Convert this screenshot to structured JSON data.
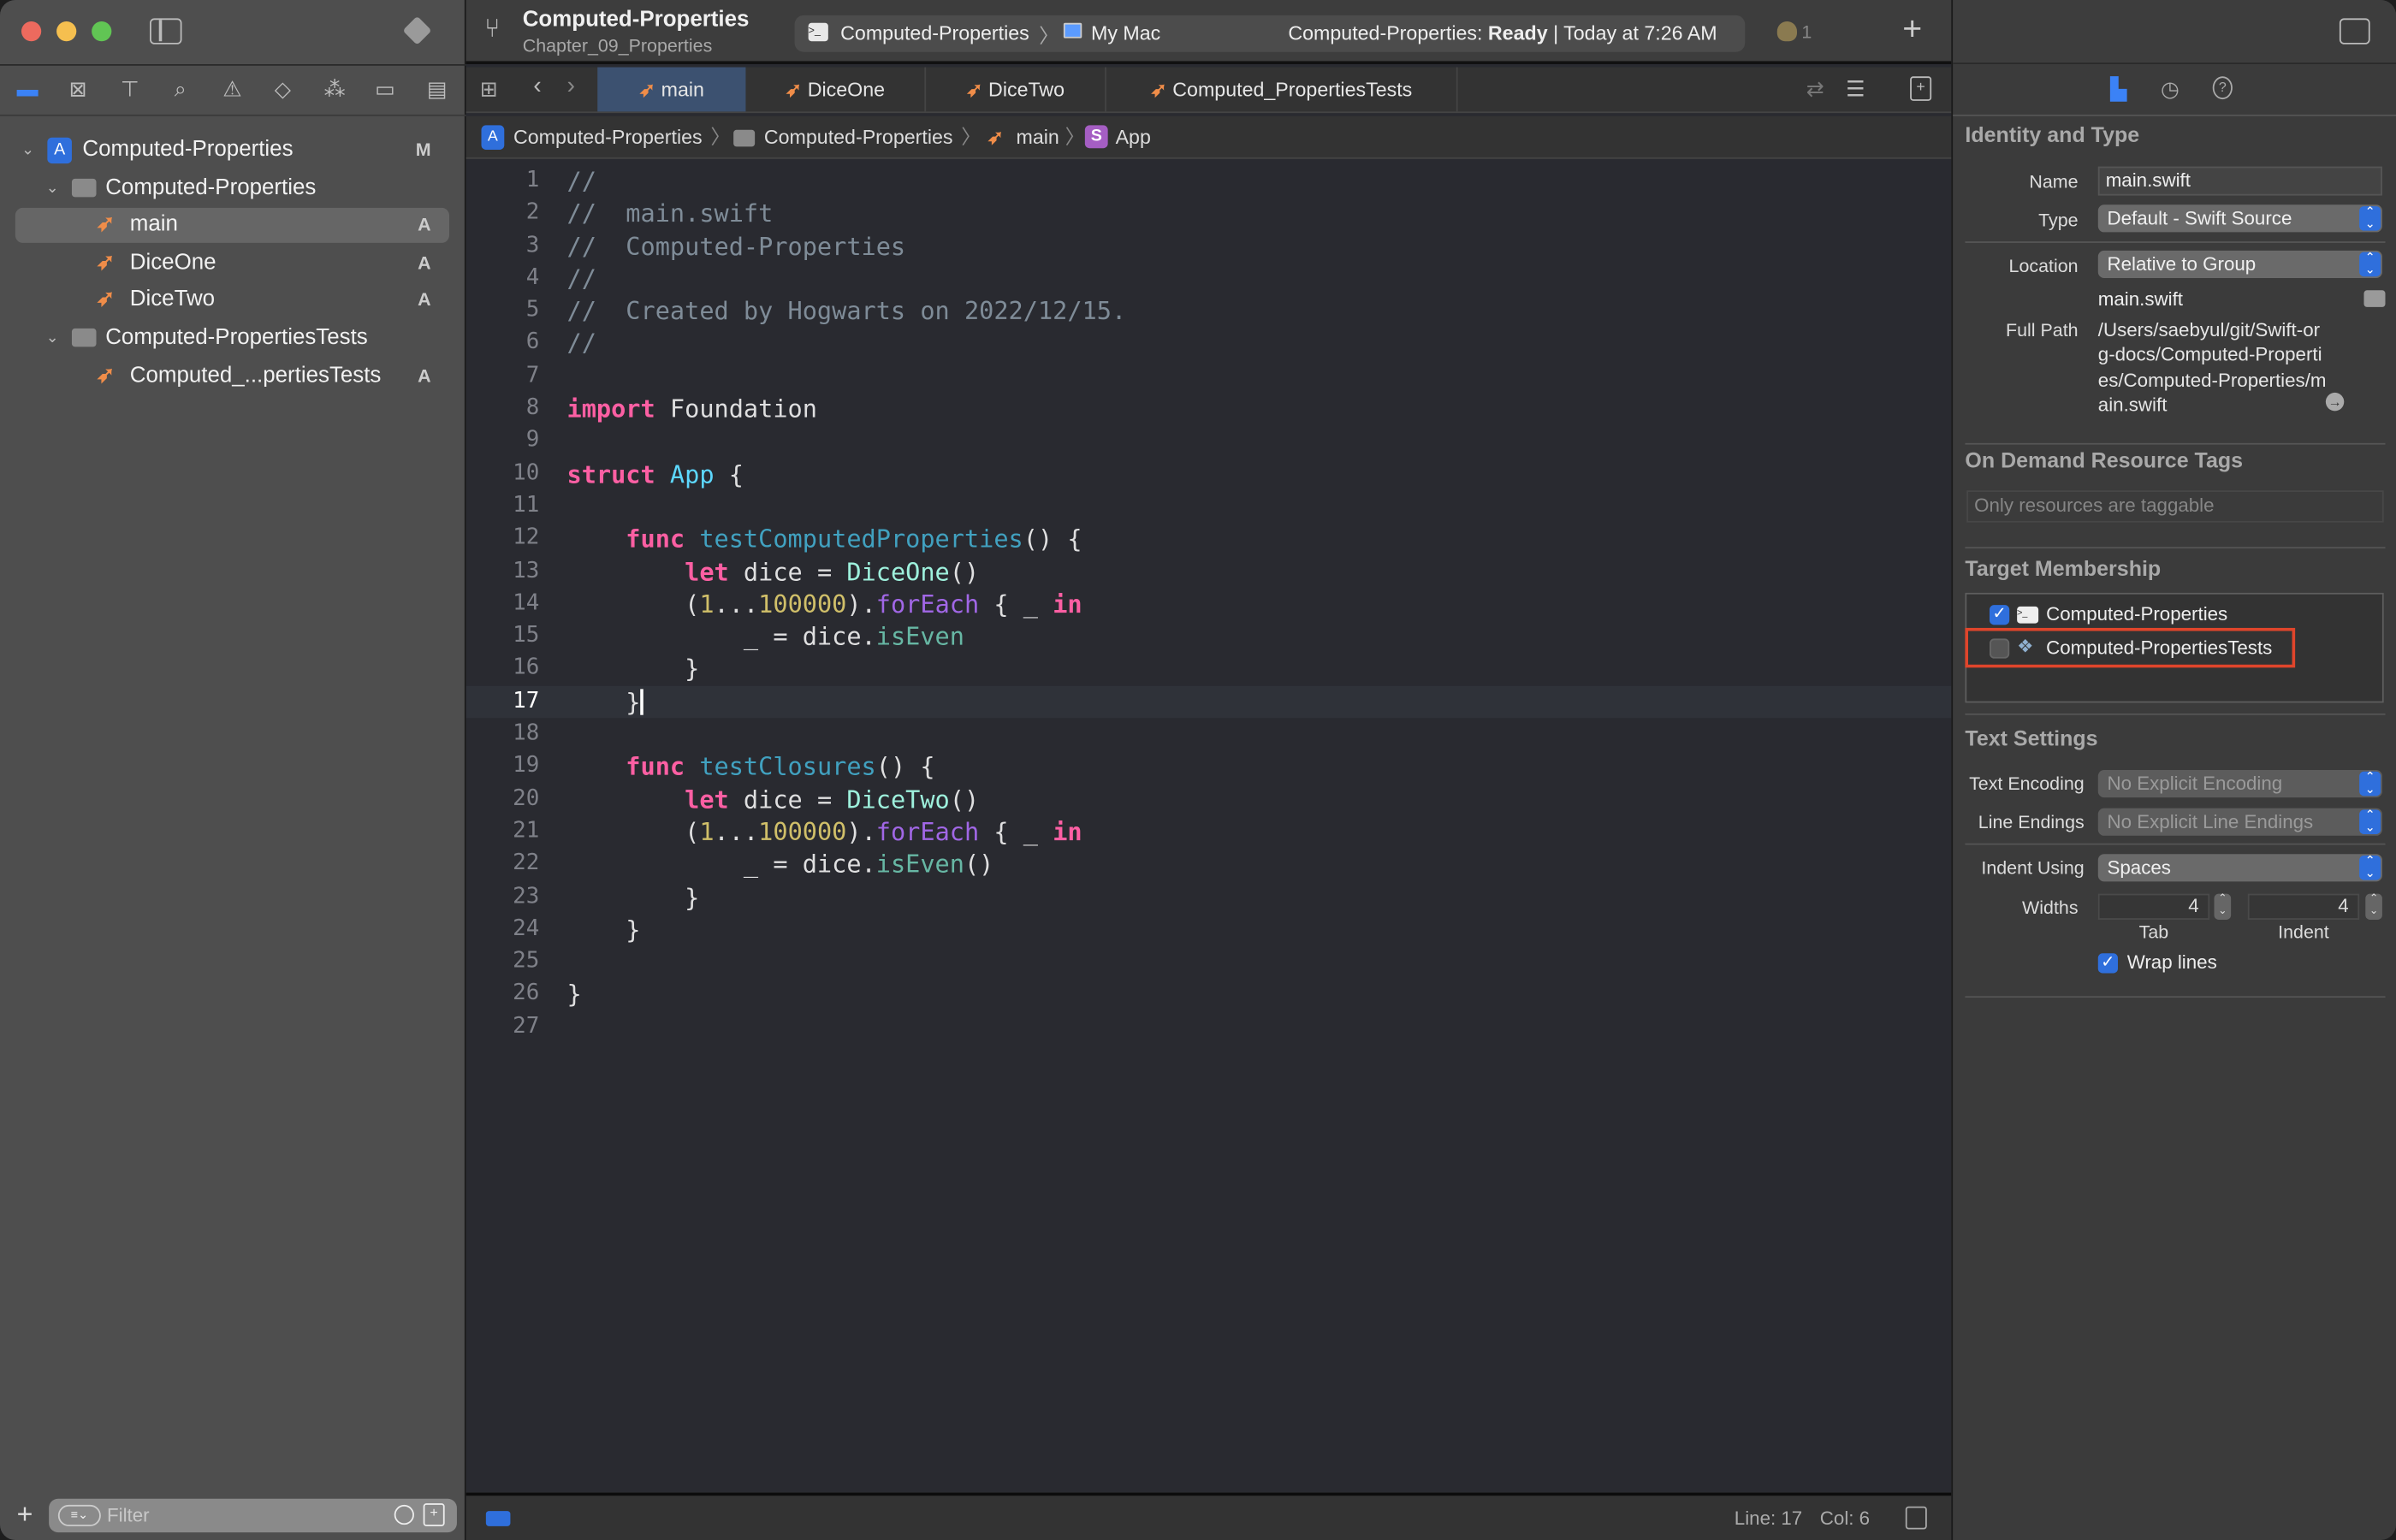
{
  "window": {
    "project_title": "Computed-Properties",
    "branch": "Chapter_09_Properties"
  },
  "toolbar": {
    "scheme": "Computed-Properties",
    "destination": "My Mac",
    "status_prefix": "Computed-Properties:",
    "status_state": "Ready",
    "status_time": "Today at 7:26 AM",
    "warning_count": "1"
  },
  "navigator": {
    "items": [
      {
        "label": "Computed-Properties",
        "badge": "M",
        "icon": "xcode-project-icon"
      },
      {
        "label": "Computed-Properties",
        "badge": "",
        "icon": "folder-icon"
      },
      {
        "label": "main",
        "badge": "A",
        "icon": "swift-file-icon",
        "selected": true
      },
      {
        "label": "DiceOne",
        "badge": "A",
        "icon": "swift-file-icon"
      },
      {
        "label": "DiceTwo",
        "badge": "A",
        "icon": "swift-file-icon"
      },
      {
        "label": "Computed-PropertiesTests",
        "badge": "",
        "icon": "folder-icon"
      },
      {
        "label": "Computed_...pertiesTests",
        "badge": "A",
        "icon": "swift-file-icon"
      }
    ],
    "filter_placeholder": "Filter"
  },
  "tabs": [
    {
      "label": "main",
      "active": true
    },
    {
      "label": "DiceOne"
    },
    {
      "label": "DiceTwo"
    },
    {
      "label": "Computed_PropertiesTests"
    }
  ],
  "jumpbar": [
    "Computed-Properties",
    "Computed-Properties",
    "main",
    "App"
  ],
  "editor": {
    "current_line": 17,
    "lines": [
      [
        [
          "comment",
          "//"
        ]
      ],
      [
        [
          "comment",
          "//  main.swift"
        ]
      ],
      [
        [
          "comment",
          "//  Computed-Properties"
        ]
      ],
      [
        [
          "comment",
          "//"
        ]
      ],
      [
        [
          "comment",
          "//  Created by Hogwarts on 2022/12/15."
        ]
      ],
      [
        [
          "comment",
          "//"
        ]
      ],
      [],
      [
        [
          "kw",
          "import"
        ],
        [
          "plain",
          " Foundation"
        ]
      ],
      [],
      [
        [
          "kw",
          "struct"
        ],
        [
          "plain",
          " "
        ],
        [
          "decl",
          "App"
        ],
        [
          "plain",
          " {"
        ]
      ],
      [],
      [
        [
          "plain",
          "    "
        ],
        [
          "kw",
          "func"
        ],
        [
          "plain",
          " "
        ],
        [
          "fn",
          "testComputedProperties"
        ],
        [
          "plain",
          "() {"
        ]
      ],
      [
        [
          "plain",
          "        "
        ],
        [
          "kw",
          "let"
        ],
        [
          "plain",
          " dice = "
        ],
        [
          "type",
          "DiceOne"
        ],
        [
          "plain",
          "()"
        ]
      ],
      [
        [
          "plain",
          "        ("
        ],
        [
          "num",
          "1"
        ],
        [
          "plain",
          "..."
        ],
        [
          "num",
          "100000"
        ],
        [
          "plain",
          ")."
        ],
        [
          "method",
          "forEach"
        ],
        [
          "plain",
          " { _ "
        ],
        [
          "kw",
          "in"
        ]
      ],
      [
        [
          "plain",
          "            _ = dice."
        ],
        [
          "prop",
          "isEven"
        ]
      ],
      [
        [
          "plain",
          "        }"
        ]
      ],
      [
        [
          "plain",
          "    }"
        ]
      ],
      [],
      [
        [
          "plain",
          "    "
        ],
        [
          "kw",
          "func"
        ],
        [
          "plain",
          " "
        ],
        [
          "fn",
          "testClosures"
        ],
        [
          "plain",
          "() {"
        ]
      ],
      [
        [
          "plain",
          "        "
        ],
        [
          "kw",
          "let"
        ],
        [
          "plain",
          " dice = "
        ],
        [
          "type",
          "DiceTwo"
        ],
        [
          "plain",
          "()"
        ]
      ],
      [
        [
          "plain",
          "        ("
        ],
        [
          "num",
          "1"
        ],
        [
          "plain",
          "..."
        ],
        [
          "num",
          "100000"
        ],
        [
          "plain",
          ")."
        ],
        [
          "method",
          "forEach"
        ],
        [
          "plain",
          " { _ "
        ],
        [
          "kw",
          "in"
        ]
      ],
      [
        [
          "plain",
          "            _ = dice."
        ],
        [
          "prop",
          "isEven"
        ],
        [
          "plain",
          "()"
        ]
      ],
      [
        [
          "plain",
          "        }"
        ]
      ],
      [
        [
          "plain",
          "    }"
        ]
      ],
      [],
      [
        [
          "plain",
          "}"
        ]
      ],
      []
    ]
  },
  "statusbar": {
    "line_label": "Line: 17",
    "col_label": "Col: 6"
  },
  "inspector": {
    "identity_header": "Identity and Type",
    "name_label": "Name",
    "name_value": "main.swift",
    "type_label": "Type",
    "type_value": "Default - Swift Source",
    "location_label": "Location",
    "location_value": "Relative to Group",
    "location_file": "main.swift",
    "fullpath_label": "Full Path",
    "fullpath_value": "/Users/saebyul/git/Swift-org-docs/Computed-Properties/Computed-Properties/main.swift",
    "odr_header": "On Demand Resource Tags",
    "odr_placeholder": "Only resources are taggable",
    "membership_header": "Target Membership",
    "targets": [
      {
        "label": "Computed-Properties",
        "checked": true
      },
      {
        "label": "Computed-PropertiesTests",
        "checked": false,
        "highlighted": true
      }
    ],
    "text_header": "Text Settings",
    "encoding_label": "Text Encoding",
    "encoding_value": "No Explicit Encoding",
    "endings_label": "Line Endings",
    "endings_value": "No Explicit Line Endings",
    "indent_label": "Indent Using",
    "indent_value": "Spaces",
    "widths_label": "Widths",
    "tab_width": "4",
    "indent_width": "4",
    "tab_caption": "Tab",
    "indent_caption": "Indent",
    "wrap_label": "Wrap lines",
    "wrap_checked": true
  },
  "colors": {
    "accent": "#2f6fdc",
    "highlight_box": "#e0452b",
    "swift_icon": "#f08d49"
  }
}
